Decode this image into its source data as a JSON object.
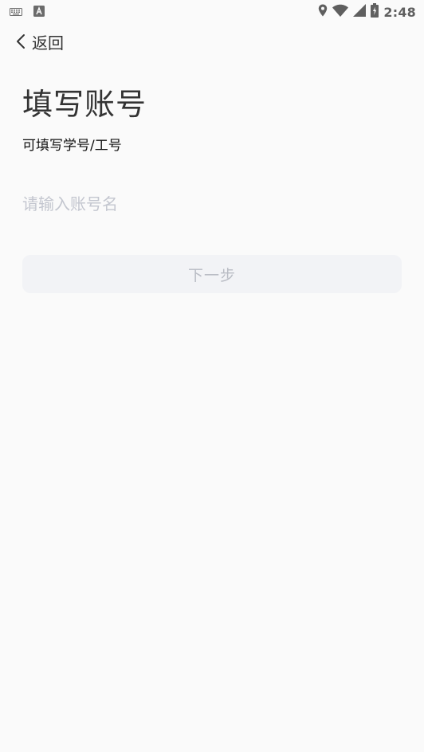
{
  "status_bar": {
    "time": "2:48",
    "left_icons": [
      "keyboard-icon",
      "font-a-icon"
    ],
    "right_icons": [
      "location-icon",
      "wifi-icon",
      "signal-icon",
      "battery-icon"
    ]
  },
  "nav": {
    "back_label": "返回"
  },
  "header": {
    "title": "填写账号",
    "subtitle": "可填写学号/工号"
  },
  "form": {
    "account_placeholder": "请输入账号名",
    "account_value": ""
  },
  "actions": {
    "next_label": "下一步"
  },
  "colors": {
    "background": "#fafafa",
    "button_bg": "#f2f3f6",
    "button_text": "#b9bcc4",
    "placeholder": "#c3c6cf"
  }
}
